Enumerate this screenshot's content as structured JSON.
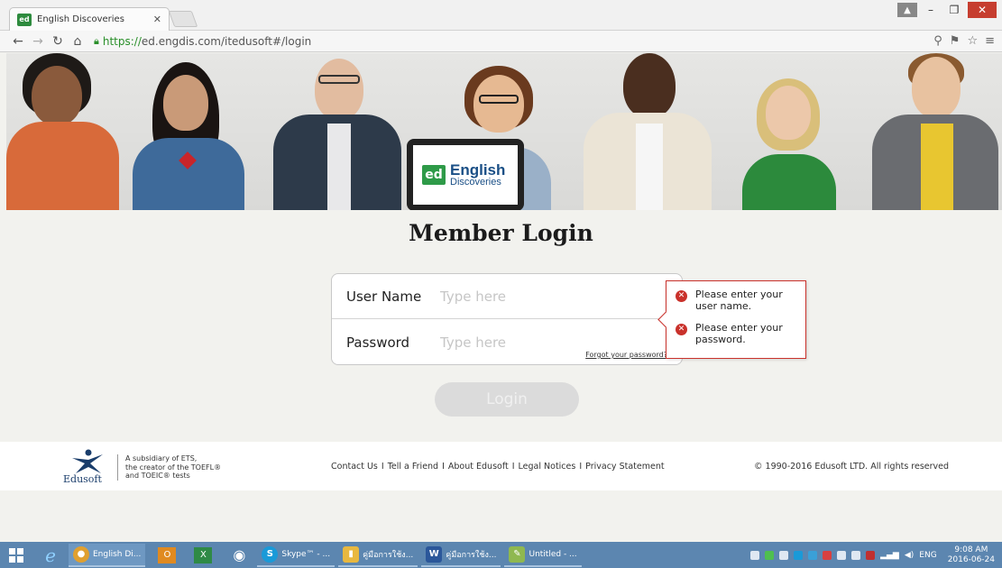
{
  "browser": {
    "tab_title": "English Discoveries",
    "favicon_text": "ed",
    "url_scheme": "https://",
    "url_rest": "ed.engdis.com/itedusoft#/login"
  },
  "hero": {
    "logo_badge": "ed",
    "brand_line1": "English",
    "brand_line2": "Discoveries"
  },
  "login": {
    "title": "Member Login",
    "username_label": "User Name",
    "username_placeholder": "Type here",
    "password_label": "Password",
    "password_placeholder": "Type here",
    "forgot_link": "Forgot your password?",
    "button_label": "Login",
    "errors": {
      "username": "Please enter your user name.",
      "password": "Please enter your password."
    }
  },
  "footer": {
    "logo_text": "Edusoft",
    "subsidiary": [
      "A subsidiary of ETS,",
      "the creator of the TOEFL®",
      "and TOEIC® tests"
    ],
    "links": [
      "Contact Us",
      "Tell a Friend",
      "About Edusoft",
      "Legal Notices",
      "Privacy Statement"
    ],
    "copyright": "© 1990-2016 Edusoft LTD. All rights reserved"
  },
  "taskbar": {
    "apps": [
      {
        "label": "English Di...",
        "color": "#e0a030",
        "icon": "chrome-icon",
        "glyph": "●"
      },
      {
        "label": "Skype™ - ...",
        "color": "#1a9ad8",
        "icon": "skype-icon",
        "glyph": "S"
      },
      {
        "label": "คู่มือการใช้ง...",
        "color": "#e8b840",
        "icon": "folder-icon",
        "glyph": "▮"
      },
      {
        "label": "คู่มือการใช้ง...",
        "color": "#2b579a",
        "icon": "word-icon",
        "glyph": "W"
      },
      {
        "label": "Untitled - ...",
        "color": "#8fb850",
        "icon": "paint-icon",
        "glyph": "✎"
      }
    ],
    "language": "ENG",
    "time": "9:08 AM",
    "date": "2016-06-24"
  },
  "colors": {
    "accent_green": "#2e9a48",
    "brand_blue": "#1a4f86",
    "error_red": "#c9312b",
    "taskbar_blue": "#5c86b0"
  }
}
